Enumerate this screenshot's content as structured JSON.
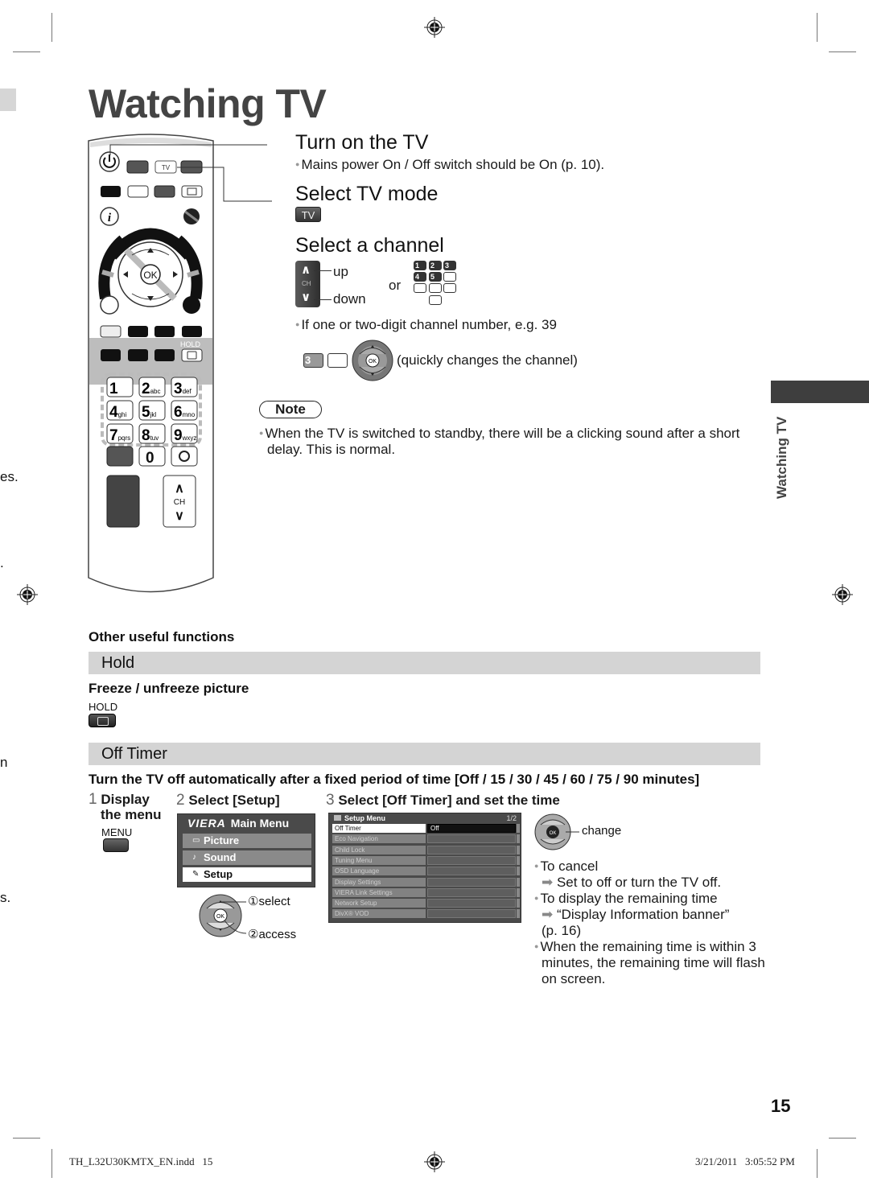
{
  "page": {
    "title": "Watching TV",
    "side_tab_label": "Watching TV",
    "page_number": "15"
  },
  "turn_on": {
    "heading": "Turn on the TV",
    "note": "Mains power On / Off switch should be On (p. 10)."
  },
  "select_mode": {
    "heading": "Select TV mode",
    "key_label": "TV"
  },
  "select_channel": {
    "heading": "Select a channel",
    "ch_up_symbol": "∧",
    "ch_label": "CH",
    "ch_down_symbol": "∨",
    "up_label": "up",
    "down_label": "down",
    "or_label": "or",
    "numpad_keys": [
      "1",
      "2",
      "3",
      "4",
      "5",
      "",
      "",
      "",
      "",
      ""
    ],
    "tip": "If one or two-digit channel number, e.g. 39",
    "example_key": "3",
    "ok_label": "OK",
    "quick_note": "(quickly changes the channel)"
  },
  "note": {
    "label": "Note",
    "text": "When the TV is switched to standby, there will be a clicking sound after a short delay. This is normal."
  },
  "remote": {
    "tv_key": "TV",
    "ok_key": "OK",
    "hold_label": "HOLD",
    "ch_label": "CH",
    "number_keys": [
      {
        "digit": "1",
        "letters": ""
      },
      {
        "digit": "2",
        "letters": "abc"
      },
      {
        "digit": "3",
        "letters": "def"
      },
      {
        "digit": "4",
        "letters": "ghi"
      },
      {
        "digit": "5",
        "letters": "jkl"
      },
      {
        "digit": "6",
        "letters": "mno"
      },
      {
        "digit": "7",
        "letters": "pqrs"
      },
      {
        "digit": "8",
        "letters": "tuv"
      },
      {
        "digit": "9",
        "letters": "wxyz"
      }
    ],
    "zero_key": "0"
  },
  "other_functions": {
    "heading": "Other useful functions",
    "hold": {
      "title": "Hold",
      "subtitle": "Freeze / unfreeze picture",
      "key_label": "HOLD"
    },
    "off_timer": {
      "title": "Off Timer",
      "description": "Turn the TV off automatically after a fixed period of time [Off / 15 / 30 / 45 / 60 / 75 / 90 minutes]",
      "steps": [
        {
          "num": "1",
          "text": "Display the menu",
          "line1": "Display",
          "line2": "the menu",
          "key_label": "MENU"
        },
        {
          "num": "2",
          "text": "Select [Setup]"
        },
        {
          "num": "3",
          "text": "Select [Off Timer] and set the time"
        }
      ],
      "main_menu": {
        "brand": "VIERA",
        "title": "Main Menu",
        "items": [
          {
            "label": "Picture",
            "icon": "▭"
          },
          {
            "label": "Sound",
            "icon": "♪"
          },
          {
            "label": "Setup",
            "icon": "✎",
            "selected": true
          }
        ]
      },
      "nav_select": "①select",
      "nav_access": "②access",
      "setup_menu": {
        "title": "Setup Menu",
        "page": "1/2",
        "items": [
          {
            "label": "Off Timer",
            "value": "Off",
            "selected": true
          },
          {
            "label": "Eco Navigation",
            "value": ""
          },
          {
            "label": "Child Lock",
            "value": ""
          },
          {
            "label": "Tuning Menu",
            "value": ""
          },
          {
            "label": "OSD Language",
            "value": ""
          },
          {
            "label": "Display Settings",
            "value": ""
          },
          {
            "label": "VIERA Link Settings",
            "value": ""
          },
          {
            "label": "Network Setup",
            "value": ""
          },
          {
            "label": "DivX® VOD",
            "value": ""
          }
        ]
      },
      "change_label": "change",
      "tips": [
        {
          "text": "To cancel",
          "arrow": "Set to off or turn the TV off."
        },
        {
          "text": "To display the remaining time",
          "arrow": "“Display Information banner”",
          "suffix": "(p. 16)"
        },
        {
          "text": "When the remaining time is within 3 minutes, the remaining time will flash on screen."
        }
      ]
    }
  },
  "footer": {
    "file": "TH_L32U30KMTX_EN.indd   15",
    "date": "3/21/2011   3:05:52 PM"
  },
  "edge_fragments": [
    "es.",
    ".",
    "n",
    "s."
  ]
}
